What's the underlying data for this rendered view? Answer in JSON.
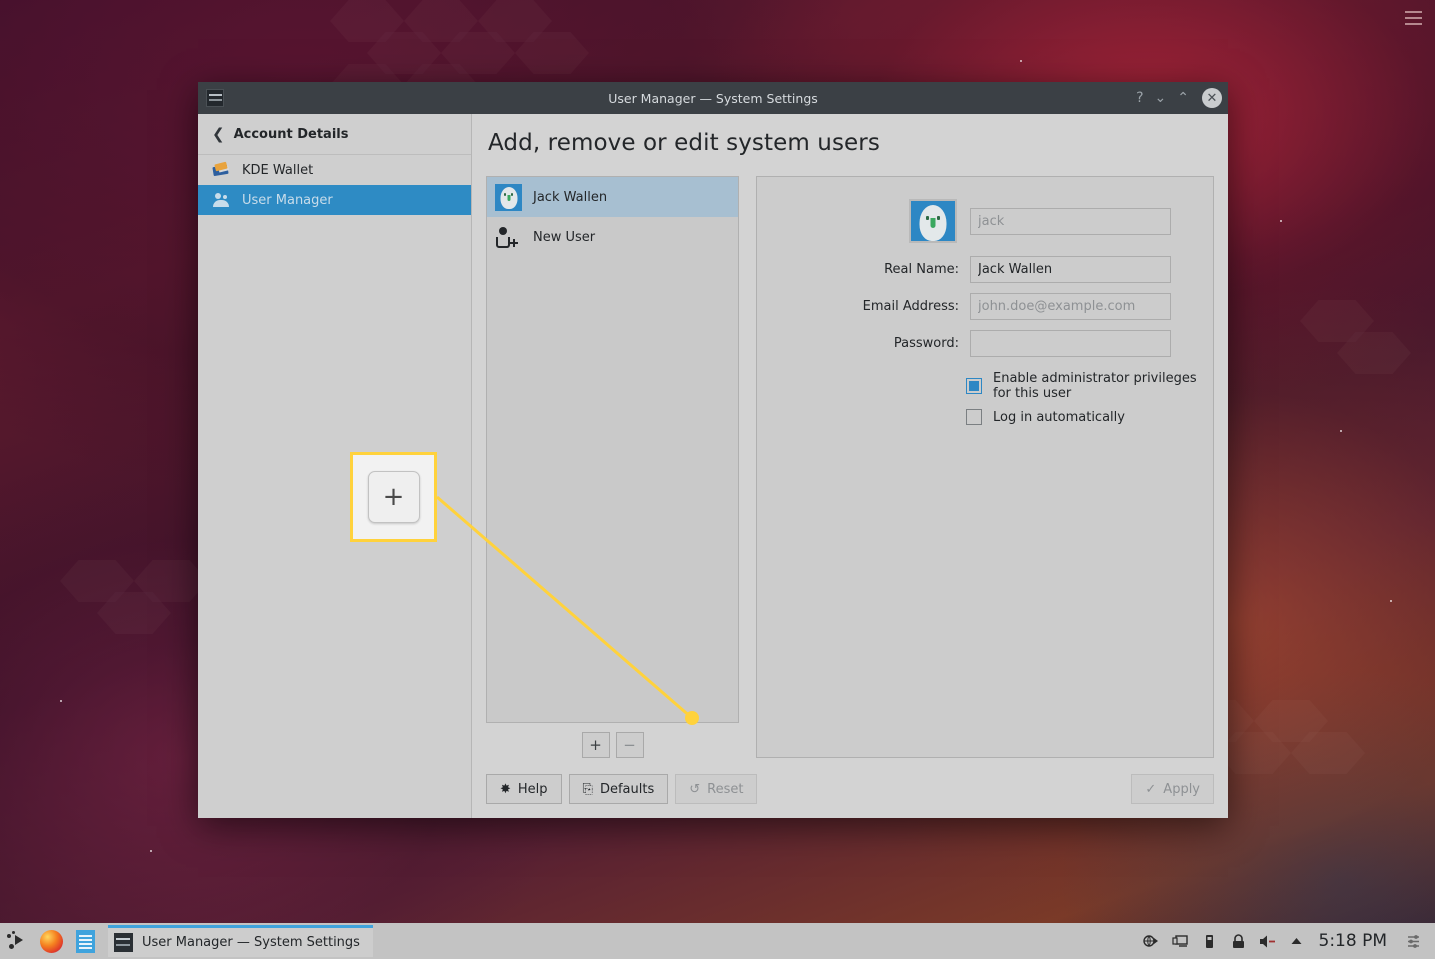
{
  "desktop": {
    "menu_icon": "hamburger-menu-icon"
  },
  "window": {
    "title": "User Manager — System Settings",
    "icon": "system-settings-icon",
    "buttons": {
      "help": "?",
      "minimize": "⌄",
      "maximize": "⌃",
      "close": "✕"
    }
  },
  "sidebar": {
    "back": {
      "label": "Account Details",
      "icon": "chevron-left-icon"
    },
    "items": [
      {
        "label": "KDE Wallet",
        "icon": "wallet-icon",
        "selected": false
      },
      {
        "label": "User Manager",
        "icon": "users-icon",
        "selected": true
      }
    ]
  },
  "main": {
    "title": "Add, remove or edit system users",
    "user_list": {
      "items": [
        {
          "label": "Jack Wallen",
          "icon": "user-avatar-icon",
          "selected": true
        },
        {
          "label": "New User",
          "icon": "add-user-icon",
          "selected": false
        }
      ],
      "tools": [
        {
          "name": "add-user-button",
          "label": "+"
        },
        {
          "name": "remove-user-button",
          "label": "−"
        }
      ]
    },
    "detail": {
      "avatar": {
        "icon": "user-avatar-icon"
      },
      "fields": [
        {
          "name": "username",
          "label": "",
          "value": "",
          "placeholder": "jack"
        },
        {
          "name": "real-name",
          "label": "Real Name:",
          "value": "Jack Wallen",
          "placeholder": ""
        },
        {
          "name": "email",
          "label": "Email Address:",
          "value": "",
          "placeholder": "john.doe@example.com"
        },
        {
          "name": "password",
          "label": "Password:",
          "value": "",
          "placeholder": ""
        }
      ],
      "checkboxes": [
        {
          "name": "admin-privileges",
          "label": "Enable administrator privileges for this user",
          "checked": true
        },
        {
          "name": "auto-login",
          "label": "Log in automatically",
          "checked": false
        }
      ]
    },
    "footer": {
      "help": {
        "label": "Help",
        "icon": "lifebuoy-icon",
        "glyph": "✸",
        "disabled": false
      },
      "defaults": {
        "label": "Defaults",
        "icon": "defaults-icon",
        "glyph": "⎘",
        "disabled": false
      },
      "reset": {
        "label": "Reset",
        "icon": "undo-icon",
        "glyph": "↺",
        "disabled": true
      },
      "apply": {
        "label": "Apply",
        "icon": "check-icon",
        "glyph": "✓",
        "disabled": true
      }
    }
  },
  "callout": {
    "plus_label": "+",
    "highlight_color": "#ffd23c",
    "name": "add-user-callout"
  },
  "taskbar": {
    "launcher": {
      "icon": "application-launcher-icon"
    },
    "pinned": [
      {
        "icon": "firefox-icon"
      },
      {
        "icon": "document-icon"
      }
    ],
    "task": {
      "label": "User Manager  — System Settings",
      "icon": "system-settings-icon"
    },
    "tray": [
      {
        "icon": "network-globe-icon",
        "glyph": "◔"
      },
      {
        "icon": "display-icon",
        "glyph": "🖵"
      },
      {
        "icon": "usb-device-icon",
        "glyph": "▤"
      },
      {
        "icon": "lock-icon",
        "glyph": "🔒"
      },
      {
        "icon": "volume-muted-icon",
        "glyph": "🔈"
      },
      {
        "icon": "show-hidden-icon",
        "glyph": "▲"
      }
    ],
    "clock": "5:18 PM",
    "settings": {
      "icon": "tray-settings-icon",
      "glyph": "⚙"
    }
  },
  "colors": {
    "accent": "#2d87c4",
    "sidebar_selected": "#2e8bc4",
    "list_selected": "#a7bfd1",
    "titlebar": "#3b4045",
    "window_bg": "#d3d3d3",
    "highlight": "#ffd23c"
  }
}
